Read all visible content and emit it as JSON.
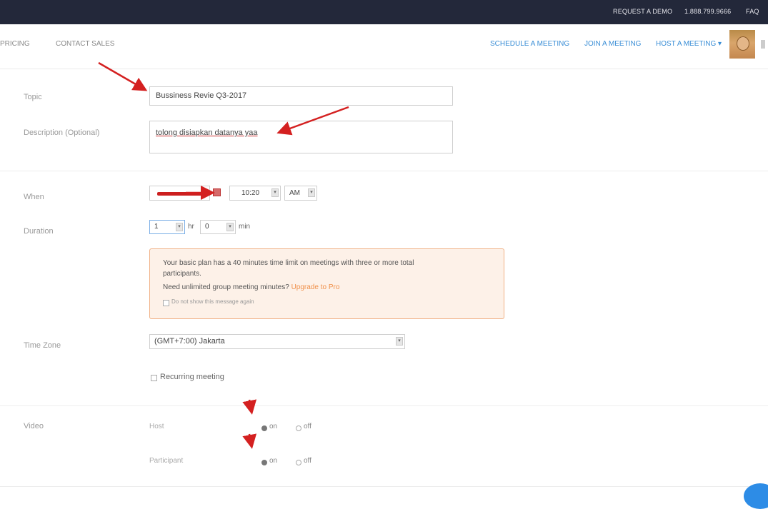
{
  "topbar": {
    "request_demo": "REQUEST A DEMO",
    "phone": "1.888.799.9666",
    "faq": "FAQ"
  },
  "nav": {
    "pricing": "PRICING",
    "contact_sales": "CONTACT SALES",
    "schedule": "SCHEDULE A MEETING",
    "join": "JOIN A MEETING",
    "host": "HOST A MEETING ▾"
  },
  "form": {
    "topic_label": "Topic",
    "topic_value": "Bussiness Revie Q3-2017",
    "desc_label": "Description (Optional)",
    "desc_value": "tolong disiapkan datanya yaa",
    "when_label": "When",
    "time_value": "10:20",
    "ampm_value": "AM",
    "duration_label": "Duration",
    "hours_value": "1",
    "hr_unit": "hr",
    "minutes_value": "0",
    "min_unit": "min",
    "warning": {
      "line1": "Your basic plan has a 40 minutes time limit on meetings with three or more total",
      "line2": "participants.",
      "line3": "Need unlimited group meeting minutes?",
      "upgrade_link": "Upgrade to Pro",
      "dont_show": "Do not show this message again"
    },
    "timezone_label": "Time Zone",
    "timezone_value": "(GMT+7:00) Jakarta",
    "recurring_label": "Recurring meeting",
    "video_label": "Video",
    "host_label": "Host",
    "participant_label": "Participant",
    "on_label": "on",
    "off_label": "off",
    "host_video": "on",
    "participant_video": "on"
  },
  "colors": {
    "topbar": "#23283a",
    "link_blue": "#3a8ed6",
    "warning_bg": "#fdf1e8",
    "warning_border": "#f0b085",
    "annotation_red": "#d42020"
  }
}
